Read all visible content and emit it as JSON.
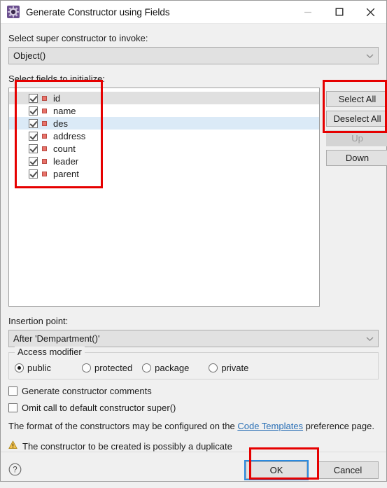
{
  "window": {
    "title": "Generate Constructor using Fields",
    "icon": "eclipse-gear-icon",
    "controls": {
      "minimize": "minimize-icon",
      "maximize": "maximize-icon",
      "close": "close-icon"
    }
  },
  "super_constructor": {
    "label": "Select super constructor to invoke:",
    "value": "Object()"
  },
  "fields_section": {
    "label": "Select fields to initialize:",
    "items": [
      {
        "name": "id",
        "checked": true,
        "highlight": "gray"
      },
      {
        "name": "name",
        "checked": true,
        "highlight": "none"
      },
      {
        "name": "des",
        "checked": true,
        "highlight": "blue"
      },
      {
        "name": "address",
        "checked": true,
        "highlight": "none"
      },
      {
        "name": "count",
        "checked": true,
        "highlight": "none"
      },
      {
        "name": "leader",
        "checked": true,
        "highlight": "none"
      },
      {
        "name": "parent",
        "checked": true,
        "highlight": "none"
      }
    ]
  },
  "side_buttons": [
    {
      "label": "Select All",
      "enabled": true
    },
    {
      "label": "Deselect All",
      "enabled": true
    },
    {
      "label": "Up",
      "enabled": false
    },
    {
      "label": "Down",
      "enabled": true
    }
  ],
  "insertion_point": {
    "label": "Insertion point:",
    "value": "After 'Dempartment()'"
  },
  "access_modifier": {
    "legend": "Access modifier",
    "options": [
      {
        "label": "public",
        "selected": true
      },
      {
        "label": "protected",
        "selected": false
      },
      {
        "label": "package",
        "selected": false
      },
      {
        "label": "private",
        "selected": false
      }
    ]
  },
  "options": [
    {
      "label": "Generate constructor comments",
      "checked": false
    },
    {
      "label": "Omit call to default constructor super()",
      "checked": false
    }
  ],
  "format_note": {
    "prefix": "The format of the constructors may be configured on the ",
    "link": "Code Templates",
    "suffix": " preference page."
  },
  "warning": {
    "icon": "warning-triangle-icon",
    "text": "The constructor to be created is possibly a duplicate"
  },
  "footer": {
    "help": "help-icon",
    "ok": "OK",
    "cancel": "Cancel"
  },
  "annotations": {
    "color": "#e60000",
    "boxes": [
      "fields-list-region",
      "select-all-buttons-region",
      "ok-button-region"
    ]
  }
}
